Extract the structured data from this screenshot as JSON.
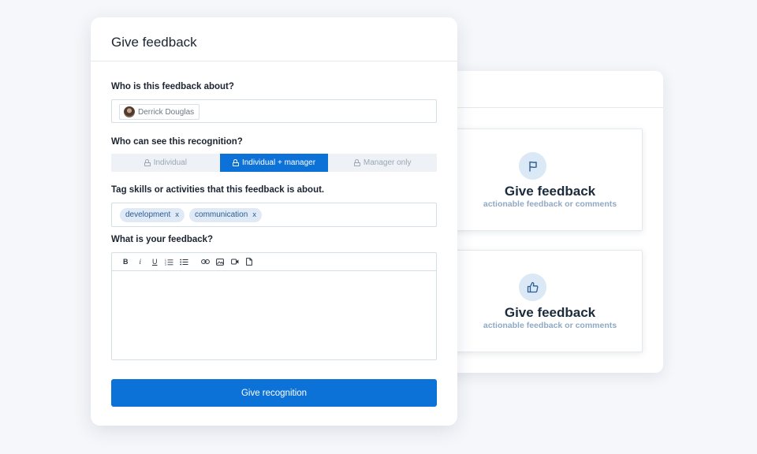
{
  "main": {
    "title": "Give feedback",
    "about_label": "Who is this feedback about?",
    "person_name": "Derrick Douglas",
    "visibility_label": "Who can see this recognition?",
    "visibility_options": [
      "Individual",
      "Individual + manager",
      "Manager only"
    ],
    "visibility_selected": "Individual + manager",
    "tags_label": "Tag skills or activities that this feedback is about.",
    "tags": [
      "development",
      "communication"
    ],
    "tag_remove": "x",
    "feedback_label": "What is your feedback?",
    "toolbar": [
      "bold-icon",
      "italic-icon",
      "underline-icon",
      "ordered-list-icon",
      "bullet-list-icon",
      "link-icon",
      "image-icon",
      "video-icon",
      "file-icon"
    ],
    "submit_label": "Give recognition",
    "accent": "#0d72d8"
  },
  "background_cards": [
    {
      "icon": "flag-icon",
      "title": "Give feedback",
      "subtitle": "actionable feedback or comments"
    },
    {
      "icon": "thumbs-up-icon",
      "title": "Give feedback",
      "subtitle": "actionable feedback or comments"
    }
  ]
}
